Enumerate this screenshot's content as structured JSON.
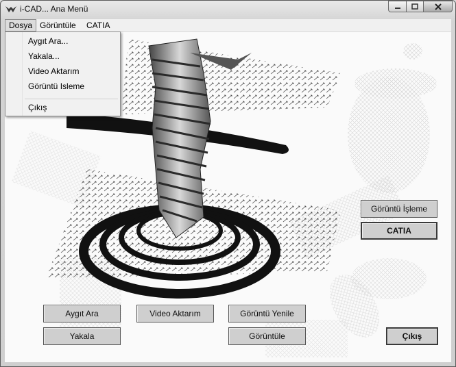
{
  "window": {
    "title": "i-CAD... Ana Menü"
  },
  "menubar": {
    "items": [
      "Dosya",
      "Görüntüle",
      "CATIA"
    ]
  },
  "dosya_menu": {
    "items": [
      "Aygıt Ara...",
      "Yakala...",
      "Video Aktarım",
      "Görüntü Isleme",
      "Çıkış"
    ]
  },
  "buttons": {
    "goruntu_isleme": "Görüntü İşleme",
    "catia": "CATIA",
    "aygit_ara": "Aygıt Ara",
    "video_aktarim": "Video Aktarım",
    "goruntu_yenile": "Görüntü Yenile",
    "yakala": "Yakala",
    "goruntule": "Görüntüle",
    "cikis": "Çıkış"
  },
  "icons": {
    "app": "bird-logo-icon",
    "minimize": "minimize-icon",
    "maximize": "maximize-icon",
    "close": "close-icon"
  }
}
